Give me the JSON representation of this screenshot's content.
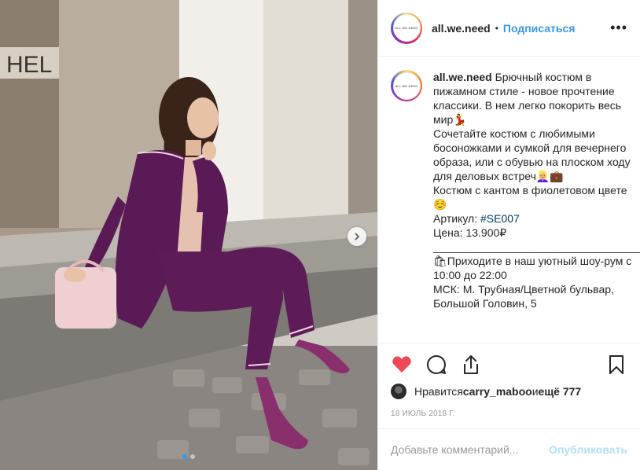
{
  "photo": {
    "wall_sign": "HEL",
    "carousel_dots": 2,
    "active_dot": 1
  },
  "header": {
    "avatar_text": "ALL WE NEED",
    "username": "all.we.need",
    "separator": "•",
    "follow_label": "Подписаться",
    "more_label": "•••"
  },
  "caption": {
    "username": "all.we.need",
    "line1": " Брючный костюм в пижамном стиле - новое прочтение классики. В нем легко покорить весь мир💃\nСочетайте костюм с любимыми босоножками и сумкой для вечернего образа, или с обувью на плоском ходу для деловых встреч👱🏼‍♀️💼\nКостюм с кантом в фиолетовом цвете☺️\nАртикул: ",
    "hashtag": "#SE007",
    "line2": "\nЦена: 13.900₽\n___________________________________\n🛍Приходите в наш уютный шоу-рум с 10:00 до 22:00\nМСК: М. Трубная/Цветной бульвар, Большой Головин, 5"
  },
  "actions": {
    "like_icon": "heart-filled-icon",
    "comment_icon": "comment-icon",
    "share_icon": "share-icon",
    "save_icon": "bookmark-icon"
  },
  "likes": {
    "prefix": "Нравится ",
    "liker": "carry_maboo",
    "middle": " и ",
    "others": "ещё 777"
  },
  "date": "18 июль 2018 г.",
  "comment": {
    "placeholder": "Добавьте комментарий...",
    "post_label": "Опубликовать"
  },
  "colors": {
    "accent": "#3897f0",
    "like": "#ed4956",
    "hashtag": "#003569",
    "post_disabled": "#b2dffc"
  }
}
